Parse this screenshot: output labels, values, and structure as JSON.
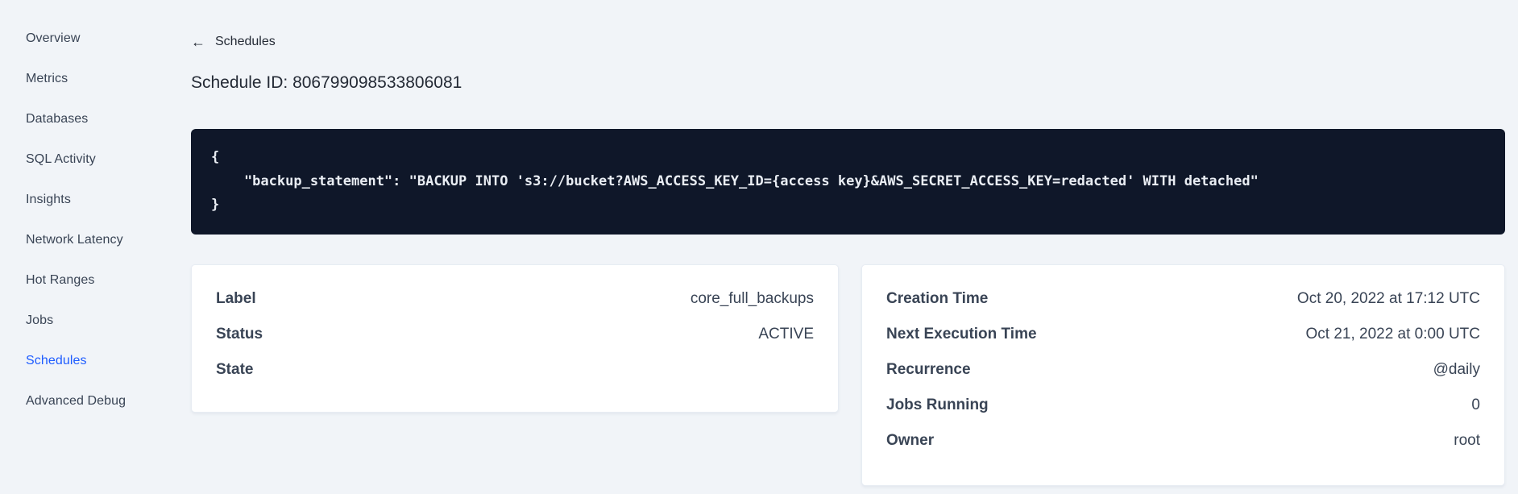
{
  "sidebar": {
    "items": [
      {
        "label": "Overview",
        "active": false
      },
      {
        "label": "Metrics",
        "active": false
      },
      {
        "label": "Databases",
        "active": false
      },
      {
        "label": "SQL Activity",
        "active": false
      },
      {
        "label": "Insights",
        "active": false
      },
      {
        "label": "Network Latency",
        "active": false
      },
      {
        "label": "Hot Ranges",
        "active": false
      },
      {
        "label": "Jobs",
        "active": false
      },
      {
        "label": "Schedules",
        "active": true
      },
      {
        "label": "Advanced Debug",
        "active": false
      }
    ]
  },
  "header": {
    "back_icon": "←",
    "back_label": "Schedules",
    "title": "Schedule ID: 806799098533806081"
  },
  "code_block": {
    "lines": [
      "{",
      "    \"backup_statement\": \"BACKUP INTO 's3://bucket?AWS_ACCESS_KEY_ID={access key}&AWS_SECRET_ACCESS_KEY=redacted' WITH detached\"",
      "}"
    ]
  },
  "details_card": {
    "rows": [
      {
        "label": "Label",
        "value": "core_full_backups"
      },
      {
        "label": "Status",
        "value": "ACTIVE"
      },
      {
        "label": "State",
        "value": ""
      }
    ]
  },
  "schedule_card": {
    "rows": [
      {
        "label": "Creation Time",
        "value": "Oct 20, 2022 at 17:12 UTC"
      },
      {
        "label": "Next Execution Time",
        "value": "Oct 21, 2022 at 0:00 UTC"
      },
      {
        "label": "Recurrence",
        "value": "@daily"
      },
      {
        "label": "Jobs Running",
        "value": "0"
      },
      {
        "label": "Owner",
        "value": "root"
      }
    ]
  },
  "colors": {
    "accent_blue": "#1e5cff",
    "code_background": "#0f1729",
    "page_background": "#f1f4f8"
  }
}
